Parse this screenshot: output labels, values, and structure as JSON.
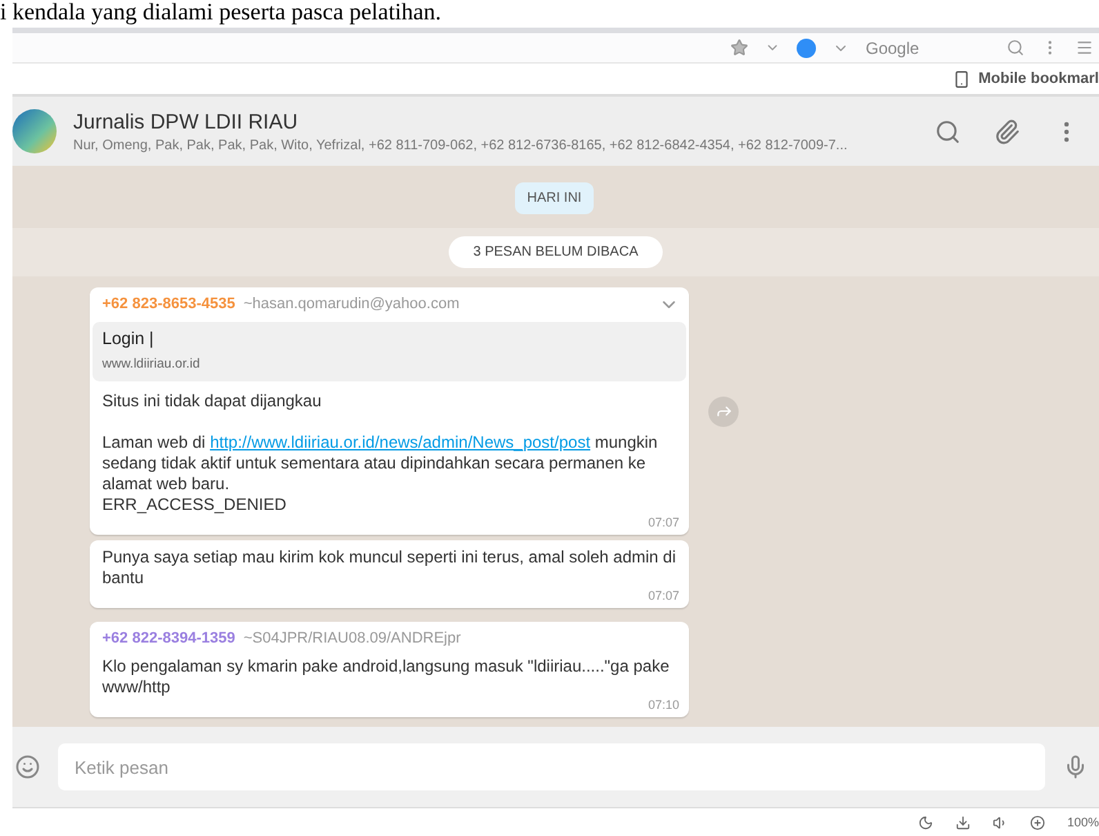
{
  "document_text": "i kendala yang dialami peserta pasca pelatihan.",
  "browser": {
    "search_engine": "Google",
    "bookmark": "Mobile bookmarl",
    "status_zoom": "100%"
  },
  "chat": {
    "title": "Jurnalis DPW LDII RIAU",
    "members": "Nur, Omeng, Pak, Pak, Pak, Pak, Wito, Yefrizal, +62 811-709-062, +62 812-6736-8165, +62 812-6842-4354, +62 812-7009-7...",
    "date_chip": "HARI INI",
    "unread_banner": "3 PESAN BELUM DIBACA"
  },
  "messages": [
    {
      "kind": "preview",
      "sender": "+62 823-8653-4535",
      "color": "#f5923e",
      "alias": "~hasan.qomarudin@yahoo.com",
      "preview_title": "Login |",
      "preview_site": "www.ldiiriau.or.id",
      "heading": "Situs ini tidak dapat dijangkau",
      "before_link": "Laman web di",
      "link": "http://www.ldiiriau.or.id/news/admin/News_post/post",
      "after_link": "mungkin sedang tidak aktif untuk sementara atau dipindahkan secara permanen ke alamat web baru.",
      "error_code": "ERR_ACCESS_DENIED",
      "time": "07:07"
    },
    {
      "kind": "plain",
      "text": "Punya saya setiap mau kirim kok muncul seperti ini terus, amal soleh admin di bantu",
      "time": "07:07"
    },
    {
      "kind": "sender",
      "sender": "+62 822-8394-1359",
      "color": "#9a7fe0",
      "alias": "~S04JPR/RIAU08.09/ANDREjpr",
      "text": "Klo pengalaman sy kmarin pake android,langsung masuk \"ldiiriau.....\"ga pake www/http",
      "time": "07:10"
    }
  ],
  "composer": {
    "placeholder": "Ketik pesan"
  }
}
